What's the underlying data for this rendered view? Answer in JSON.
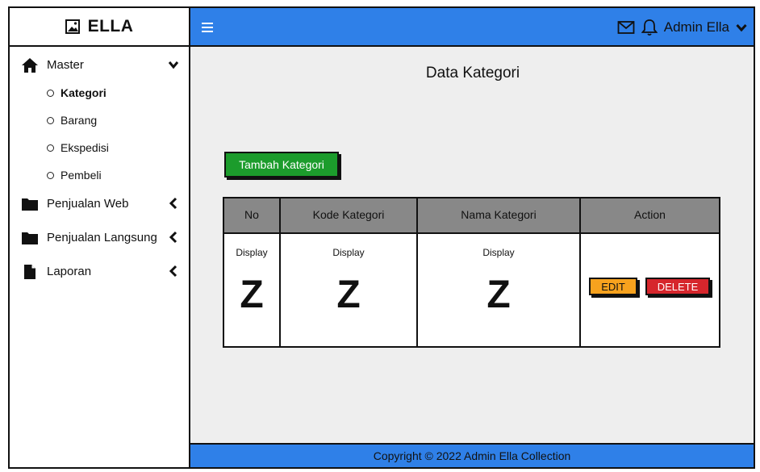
{
  "brand": {
    "title": "ELLA"
  },
  "sidebar": {
    "items": [
      {
        "label": "Master",
        "icon": "home-icon",
        "chevron": "down"
      },
      {
        "label": "Penjualan Web",
        "icon": "folder-icon",
        "chevron": "left"
      },
      {
        "label": "Penjualan Langsung",
        "icon": "folder-icon",
        "chevron": "left"
      },
      {
        "label": "Laporan",
        "icon": "file-icon",
        "chevron": "left"
      }
    ],
    "master_sub": [
      "Kategori",
      "Barang",
      "Ekspedisi",
      "Pembeli"
    ],
    "active_sub": "Kategori"
  },
  "header": {
    "user_label": "Admin Ella",
    "bar_color": "#2f80e8"
  },
  "main": {
    "title": "Data Kategori",
    "add_button": "Tambah Kategori",
    "table": {
      "columns": [
        "No",
        "Kode Kategori",
        "Nama Kategori",
        "Action"
      ],
      "placeholder_small": "Display",
      "placeholder_big": "Z",
      "edit_label": "EDIT",
      "delete_label": "DELETE"
    }
  },
  "footer": {
    "text": "Copyright © 2022 Admin Ella Collection"
  }
}
